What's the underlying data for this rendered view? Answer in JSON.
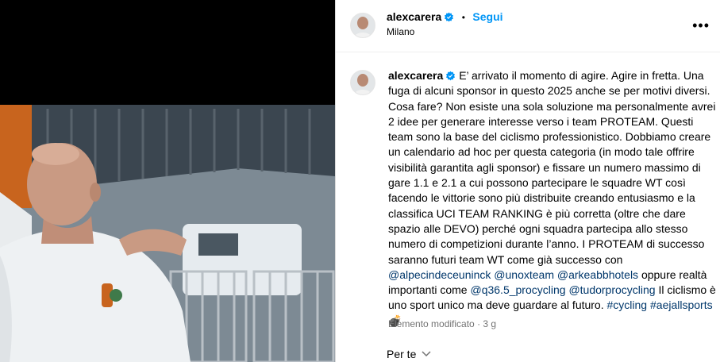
{
  "post": {
    "username": "alexcarera",
    "follow_label": "Segui",
    "separator": "•",
    "location": "Milano",
    "more_label": "•••"
  },
  "caption": {
    "username": "alexcarera",
    "text_1": "E’ arrivato il momento di agire. Agire in fretta. Una fuga di alcuni sponsor in questo 2025 anche se per motivi diversi. Cosa fare? Non esiste una sola soluzione ma personalmente avrei 2 idee per generare interesse verso i team PROTEAM. Questi team sono la base del ciclismo professionistico. Dobbiamo creare un calendario ad hoc per questa categoria (in modo tale offrire visibilità garantita agli sponsor) e fissare un numero massimo di gare 1.1 e 2.1 a cui possono partecipare le squadre WT così facendo le vittorie sono più distribuite creando entusiasmo e la classifica UCI TEAM RANKING è più corretta (oltre che dare spazio alle DEVO) perché ogni squadra partecipa allo stesso numero di competizioni durante l’anno. I PROTEAM di successo saranno futuri team WT come già successo con",
    "mention_1": "@alpecindeceuninck",
    "mention_2": "@unoxteam",
    "mention_3": "@arkeabbhotels",
    "text_2": "oppure realtà importanti come",
    "mention_4": "@q36.5_procycling",
    "mention_5": "@tudorprocycling",
    "text_3": "Il ciclismo è uno sport unico ma deve guardare al futuro.",
    "hashtag_1": "#cycling",
    "hashtag_2": "#aejallsports",
    "emoji": "💣"
  },
  "meta": {
    "edited": "Elemento modificato",
    "dot": "·",
    "age": "3 g"
  },
  "perte": {
    "label": "Per te"
  },
  "colors": {
    "follow": "#0095f6",
    "link": "#00376b",
    "verified": "#0095f6",
    "muted": "#737373"
  }
}
